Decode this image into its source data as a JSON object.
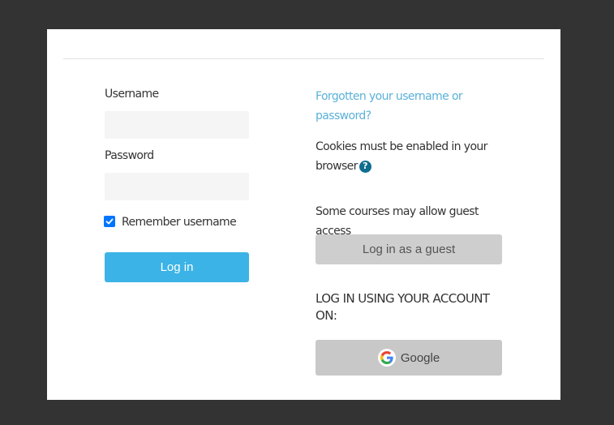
{
  "login_form": {
    "username_label": "Username",
    "username_value": "",
    "password_label": "Password",
    "password_value": "",
    "remember_label": "Remember username",
    "remember_checked": true,
    "login_button": "Log in"
  },
  "help": {
    "forgot_link": "Forgotten your username or password?",
    "cookies_text": "Cookies must be enabled in your browser",
    "help_icon": "question-circle-icon"
  },
  "guest": {
    "text": "Some courses may allow guest access",
    "button": "Log in as a guest"
  },
  "oauth": {
    "heading": "LOG IN USING YOUR ACCOUNT ON:",
    "google_button": "Google",
    "google_icon": "google-logo-icon"
  },
  "colors": {
    "background": "#333333",
    "card": "#ffffff",
    "primary": "#3bb3e6",
    "link": "#5ab1d8",
    "help_icon": "#0f6e8f",
    "guest_button": "#cecece",
    "google_button": "#c8c8c8"
  }
}
